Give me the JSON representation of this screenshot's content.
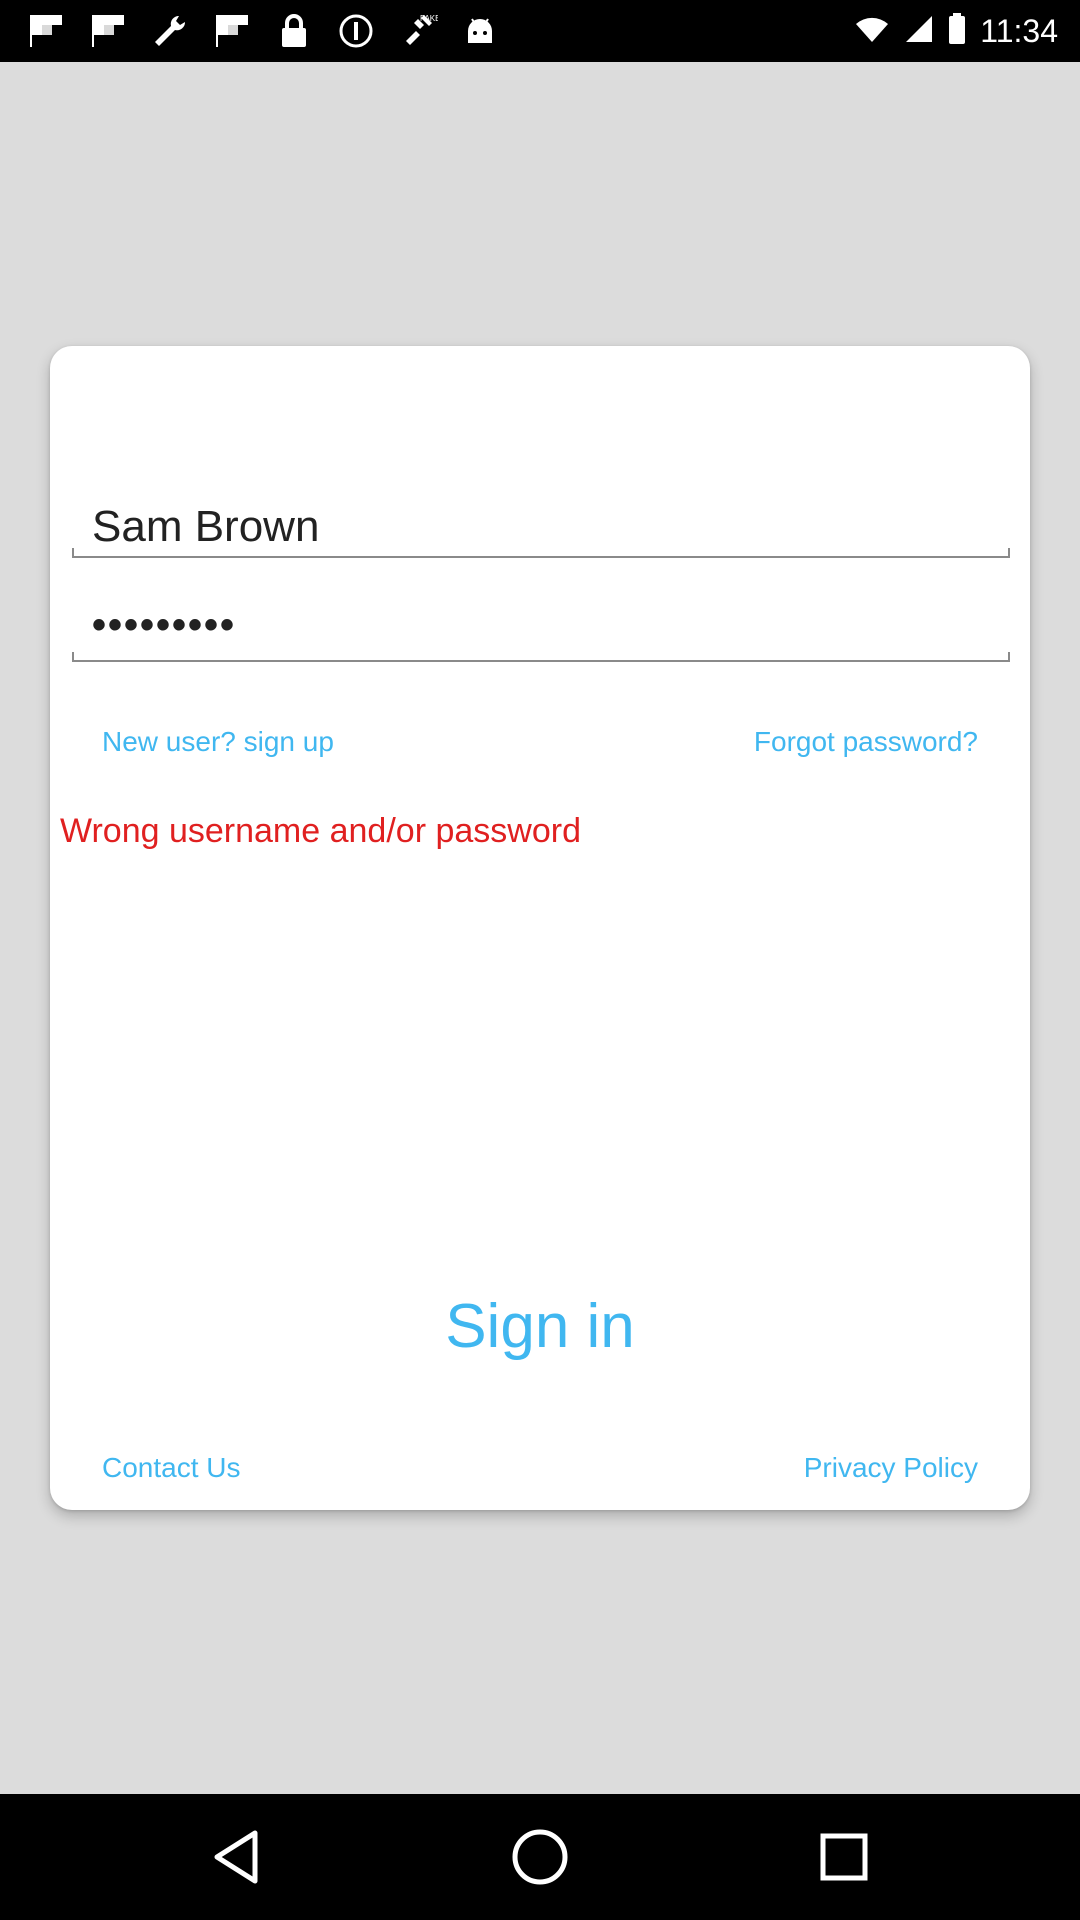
{
  "status_bar": {
    "time": "11:34",
    "icons": [
      "flipboard-icon",
      "flipboard-icon",
      "wrench-icon",
      "flipboard-icon",
      "lock-icon",
      "info-icon",
      "fake-gps-icon",
      "android-icon"
    ],
    "right_icons": [
      "wifi-icon",
      "cell-signal-icon",
      "battery-icon"
    ]
  },
  "login": {
    "username_value": "Sam Brown",
    "password_value": "•••••••••",
    "signup_label": "New user? sign up",
    "forgot_label": "Forgot password?",
    "error_message": "Wrong username and/or password",
    "signin_label": "Sign in",
    "contact_label": "Contact Us",
    "privacy_label": "Privacy Policy"
  },
  "colors": {
    "accent": "#40b7f0",
    "error": "#e02020",
    "background": "#dcdcdc",
    "card": "#ffffff"
  },
  "nav_bar": {
    "buttons": [
      "back-icon",
      "home-icon",
      "recent-apps-icon"
    ]
  }
}
